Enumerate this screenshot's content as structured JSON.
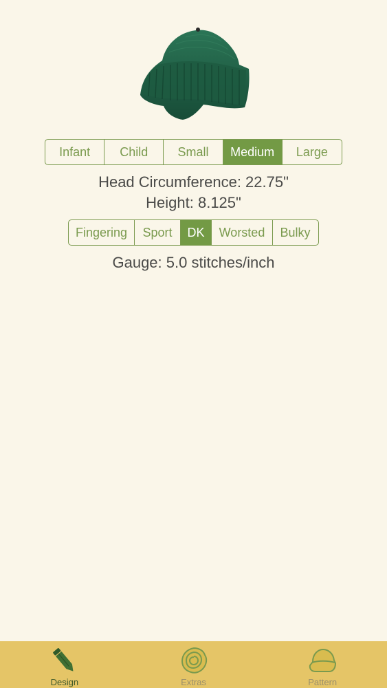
{
  "size_options": [
    "Infant",
    "Child",
    "Small",
    "Medium",
    "Large"
  ],
  "selected_size": "Medium",
  "head_circumference": "Head Circumference: 22.75\"",
  "height": "Height: 8.125\"",
  "yarn_options": [
    "Fingering",
    "Sport",
    "DK",
    "Worsted",
    "Bulky"
  ],
  "selected_yarn": "DK",
  "gauge": "Gauge: 5.0 stitches/inch",
  "tabs": [
    {
      "label": "Design",
      "icon": "pencil-icon",
      "active": true
    },
    {
      "label": "Extras",
      "icon": "rose-icon",
      "active": false
    },
    {
      "label": "Pattern",
      "icon": "hat-icon",
      "active": false
    }
  ],
  "colors": {
    "background": "#faf6e9",
    "accent": "#739a45",
    "tabbar": "#e5c567",
    "hat": "#1f5e45"
  }
}
